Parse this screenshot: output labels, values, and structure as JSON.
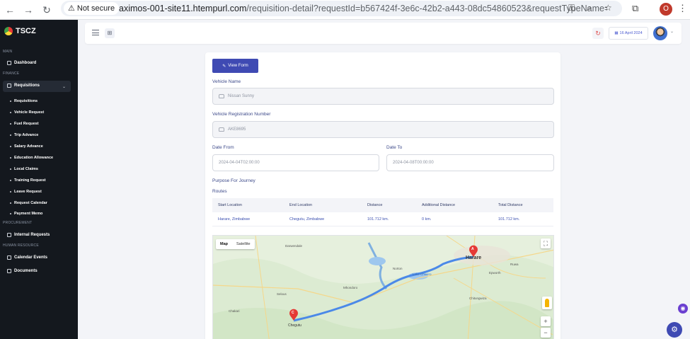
{
  "browser": {
    "security_label": "Not secure",
    "url_host": "aximos-001-site11.htempurl.com",
    "url_path": "/requisition-detail?requestId=b567424f-3e6c-42b2-a443-08dc54860523&requestTypeName=Veh...",
    "profile_initial": "O"
  },
  "sidebar": {
    "brand": "TSCZ",
    "sections": {
      "main": "MAIN",
      "finance": "FINANCE",
      "procurement": "PROCUREMENT",
      "human_resource": "HUMAN RESOURCE"
    },
    "dashboard": "Dashboard",
    "requisitions_group": "Requisitions",
    "sub_items": [
      "Requisitions",
      "Vehicle Request",
      "Fuel Request",
      "Trip Advance",
      "Salary Advance",
      "Education Allowance",
      "Local Claims",
      "Training Request",
      "Leave Request",
      "Request Calendar",
      "Payment Memo"
    ],
    "internal_requests": "Internal Requests",
    "calendar_events": "Calendar Events",
    "documents": "Documents"
  },
  "header": {
    "date": "16 April 2024"
  },
  "form": {
    "view_form_label": "View Form",
    "vehicle_name_label": "Vehicle Name",
    "vehicle_name_value": "Nissan Sunny",
    "reg_number_label": "Vehicle Registration Number",
    "reg_number_value": "AKE8695",
    "date_from_label": "Date From",
    "date_from_value": "2024-04-04T02:00:00",
    "date_to_label": "Date To",
    "date_to_value": "2024-04-08T00:00:00",
    "purpose_label": "Purpose For Journey",
    "routes_label": "Routes"
  },
  "routes_table": {
    "headers": [
      "Start Location",
      "End Location",
      "Distance",
      "Additional Distance",
      "Total Distance"
    ],
    "rows": [
      [
        "Harare, Zimbabwe",
        "Chegutu, Zimbabwe",
        "101.712 km.",
        "0 km.",
        "101.712 km."
      ]
    ]
  },
  "map": {
    "map_label": "Map",
    "satellite_label": "Satellite",
    "marker_a": "A",
    "marker_c": "C",
    "places": {
      "harare": "Harare",
      "chegutu": "Chegutu",
      "norton": "Norton",
      "lake_chivero": "Lake Chivero",
      "mhondoro": "Mhondoro",
      "selous": "Selous",
      "chitungwiza": "Chitungwiza",
      "darwendale": "Darwendale",
      "epworth": "Epworth",
      "kadoma": "Chakari",
      "ruwa": "Ruwa"
    }
  }
}
